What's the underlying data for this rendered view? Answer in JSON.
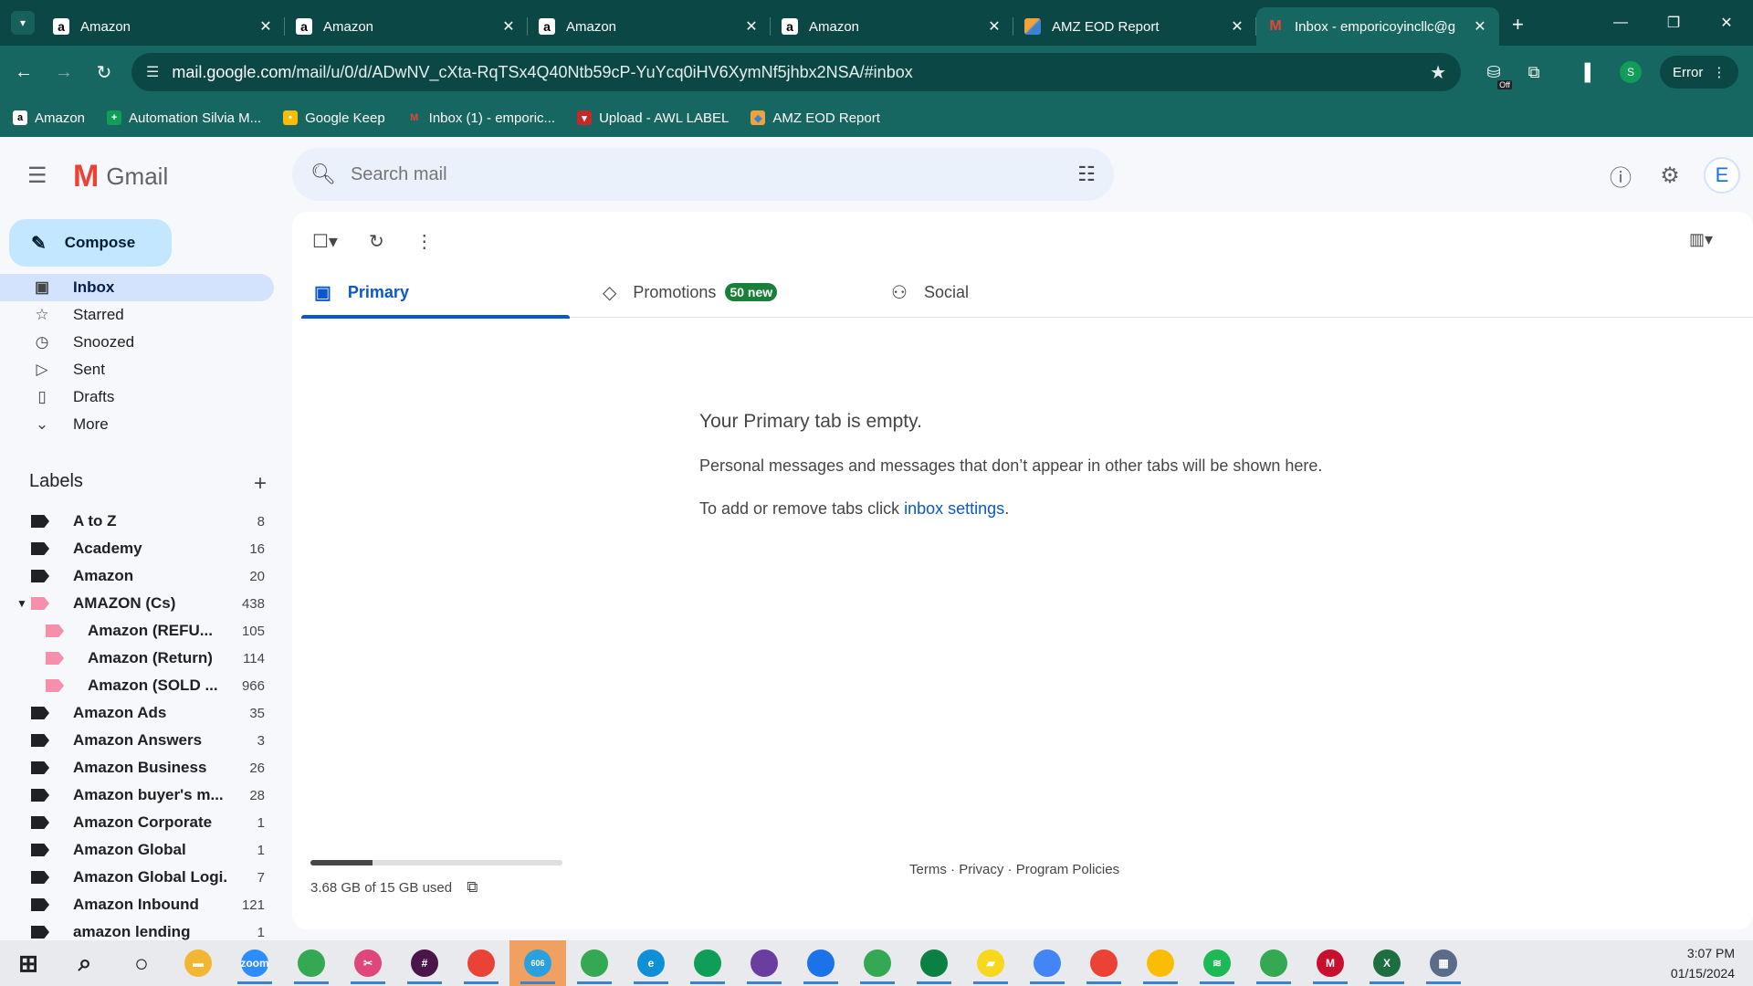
{
  "browser": {
    "tabs": [
      {
        "title": "Amazon",
        "favicon": "amazon-icon"
      },
      {
        "title": "Amazon",
        "favicon": "amazon-icon"
      },
      {
        "title": "Amazon",
        "favicon": "amazon-icon"
      },
      {
        "title": "Amazon",
        "favicon": "amazon-icon"
      },
      {
        "title": "AMZ EOD Report",
        "favicon": "eod-report-icon"
      },
      {
        "title": "Inbox - emporicoyincllc@g",
        "favicon": "gmail-icon",
        "active": true
      }
    ],
    "url_host": "mail.google.com",
    "url_path": "/mail/u/0/d/ADwNV_cXta-RqTSx4Q40Ntb59cP-YuYcq0iHV6XymNf5jhbx2NSA/#inbox",
    "profile_initial": "S",
    "error_label": "Error",
    "extension_badge": "Off",
    "bookmarks": [
      {
        "label": "Amazon",
        "icon": "amazon-icon"
      },
      {
        "label": "Automation Silvia M...",
        "icon": "sheets-icon"
      },
      {
        "label": "Google Keep",
        "icon": "keep-icon"
      },
      {
        "label": "Inbox (1) - emporic...",
        "icon": "gmail-icon"
      },
      {
        "label": "Upload - AWL LABEL",
        "icon": "upload-icon"
      },
      {
        "label": "AMZ EOD Report",
        "icon": "eod-report-icon"
      }
    ]
  },
  "gmail": {
    "app_name": "Gmail",
    "search_placeholder": "Search mail",
    "compose_label": "Compose",
    "folders": [
      {
        "label": "Inbox",
        "icon": "inbox-icon",
        "active": true
      },
      {
        "label": "Starred",
        "icon": "star-icon"
      },
      {
        "label": "Snoozed",
        "icon": "clock-icon"
      },
      {
        "label": "Sent",
        "icon": "send-icon"
      },
      {
        "label": "Drafts",
        "icon": "draft-icon"
      },
      {
        "label": "More",
        "icon": "chevron-down-icon"
      }
    ],
    "labels_heading": "Labels",
    "labels": [
      {
        "name": "A to Z",
        "count": "8"
      },
      {
        "name": "Academy",
        "count": "16"
      },
      {
        "name": "Amazon",
        "count": "20"
      },
      {
        "name": "AMAZON (Cs)",
        "count": "438",
        "color": "#f58fac",
        "expanded": true
      },
      {
        "name": "Amazon (REFU...",
        "count": "105",
        "color": "#f58fac",
        "sub": true
      },
      {
        "name": "Amazon (Return)",
        "count": "114",
        "color": "#f58fac",
        "sub": true
      },
      {
        "name": "Amazon (SOLD ...",
        "count": "966",
        "color": "#f58fac",
        "sub": true
      },
      {
        "name": "Amazon Ads",
        "count": "35"
      },
      {
        "name": "Amazon Answers",
        "count": "3"
      },
      {
        "name": "Amazon Business",
        "count": "26"
      },
      {
        "name": "Amazon buyer's m...",
        "count": "28"
      },
      {
        "name": "Amazon Corporate",
        "count": "1"
      },
      {
        "name": "Amazon Global",
        "count": "1"
      },
      {
        "name": "Amazon Global Logi...",
        "count": "7"
      },
      {
        "name": "Amazon Inbound",
        "count": "121"
      },
      {
        "name": "amazon lending",
        "count": "1"
      }
    ],
    "avatar_initial": "E",
    "category_tabs": [
      {
        "label": "Primary",
        "icon": "inbox-tab-icon",
        "active": true
      },
      {
        "label": "Promotions",
        "icon": "tag-icon",
        "badge": "50 new"
      },
      {
        "label": "Social",
        "icon": "people-icon"
      }
    ],
    "empty_title": "Your Primary tab is empty.",
    "empty_desc": "Personal messages and messages that don’t appear in other tabs will be shown here.",
    "empty_hint_prefix": "To add or remove tabs click ",
    "empty_hint_link": "inbox settings",
    "empty_hint_suffix": ".",
    "storage_text": "3.68 GB of 15 GB used",
    "storage_fraction": 0.245,
    "footer_terms": "Terms",
    "footer_privacy": "Privacy",
    "footer_policies": "Program Policies",
    "footer_sep": " · "
  },
  "taskbar": {
    "apps": [
      {
        "name": "windows-start-icon",
        "color": "#202124"
      },
      {
        "name": "search-icon",
        "color": "#202124"
      },
      {
        "name": "task-view-icon",
        "color": "#202124"
      },
      {
        "name": "file-explorer-icon",
        "color": "#f2b632"
      },
      {
        "name": "zoom-icon",
        "color": "#2d8cff",
        "text": "zoom"
      },
      {
        "name": "chrome-icon",
        "color": "#34a853"
      },
      {
        "name": "snipping-tool-icon",
        "color": "#e0457b"
      },
      {
        "name": "slack-icon",
        "color": "#4a154b"
      },
      {
        "name": "chrome-profile-icon",
        "color": "#ea4335"
      },
      {
        "name": "telegram-icon",
        "color": "#2aa1de",
        "text": "606"
      },
      {
        "name": "chrome-profile-icon",
        "color": "#34a853"
      },
      {
        "name": "edge-icon",
        "color": "#0f8fd6"
      },
      {
        "name": "chrome-profile-icon",
        "color": "#0f9d58"
      },
      {
        "name": "chrome-profile-icon",
        "color": "#6a3ea1"
      },
      {
        "name": "chrome-profile-icon",
        "color": "#1a73e8"
      },
      {
        "name": "chrome-profile-icon",
        "color": "#34a853"
      },
      {
        "name": "chrome-profile-icon",
        "color": "#0b8043"
      },
      {
        "name": "sticky-notes-icon",
        "color": "#f9d71c"
      },
      {
        "name": "chrome-profile-icon",
        "color": "#4285f4"
      },
      {
        "name": "chrome-profile-icon",
        "color": "#ea4335"
      },
      {
        "name": "chrome-profile-icon",
        "color": "#fbbc04"
      },
      {
        "name": "spotify-icon",
        "color": "#1db954"
      },
      {
        "name": "chrome-profile-icon",
        "color": "#34a853"
      },
      {
        "name": "mcafee-icon",
        "color": "#c8102e"
      },
      {
        "name": "excel-icon",
        "color": "#1d6f42"
      },
      {
        "name": "calculator-icon",
        "color": "#5b6b8a"
      }
    ],
    "time": "3:07 PM",
    "date": "01/15/2024"
  }
}
